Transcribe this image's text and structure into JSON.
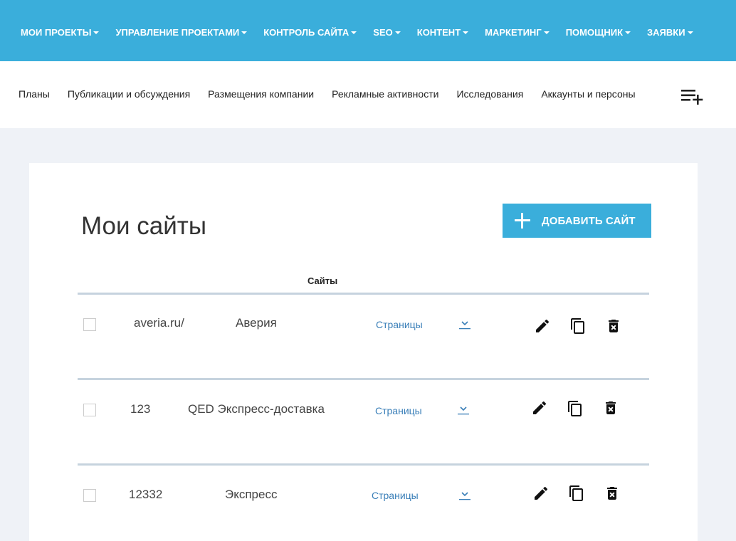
{
  "topnav": {
    "items": [
      {
        "label": "МОИ ПРОЕКТЫ"
      },
      {
        "label": "УПРАВЛЕНИЕ ПРОЕКТАМИ"
      },
      {
        "label": "КОНТРОЛЬ САЙТА"
      },
      {
        "label": "SEO"
      },
      {
        "label": "КОНТЕНТ"
      },
      {
        "label": "МАРКЕТИНГ"
      },
      {
        "label": "ПОМОЩНИК"
      },
      {
        "label": "ЗАЯВКИ"
      }
    ]
  },
  "subnav": {
    "items": [
      {
        "label": "Планы"
      },
      {
        "label": "Публикации и обсуждения"
      },
      {
        "label": "Размещения компании"
      },
      {
        "label": "Рекламные активности"
      },
      {
        "label": "Исследования"
      },
      {
        "label": "Аккаунты и персоны"
      }
    ],
    "add_icon": "playlist-add-icon"
  },
  "main": {
    "title": "Мои сайты",
    "add_button_label": "ДОБАВИТЬ САЙТ",
    "column_header": "Сайты",
    "rows": [
      {
        "domain": "averia.ru/",
        "name": "Аверия",
        "pages_label": "Страницы"
      },
      {
        "domain": "123",
        "name": "QED Экспресс-доставка",
        "pages_label": "Страницы"
      },
      {
        "domain": "12332",
        "name": "Экспресс",
        "pages_label": "Страницы"
      }
    ]
  },
  "colors": {
    "accent": "#3aaedb",
    "link": "#3a7fb8",
    "divider": "#c6d3de",
    "background": "#eff2f7"
  }
}
